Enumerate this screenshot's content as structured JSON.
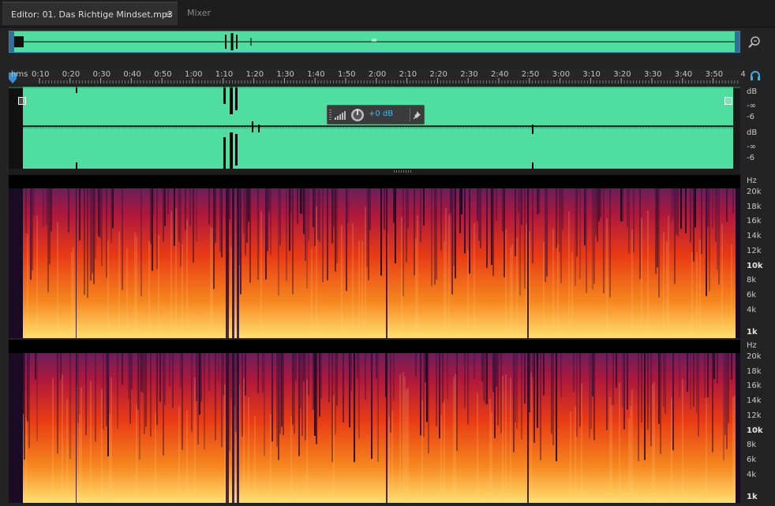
{
  "tabs": {
    "editor_label": "Editor: 01. Das Richtige Mindset.mp3",
    "menu_glyph": "≡",
    "mixer_label": "Mixer"
  },
  "ruler": {
    "unit_label": "hms",
    "tick_labels": [
      "0:10",
      "0:20",
      "0:30",
      "0:40",
      "0:50",
      "1:00",
      "1:10",
      "1:20",
      "1:30",
      "1:40",
      "1:50",
      "2:00",
      "2:10",
      "2:20",
      "2:30",
      "2:40",
      "2:50",
      "3:00",
      "3:10",
      "3:20",
      "3:30",
      "3:40",
      "3:50",
      "4"
    ]
  },
  "waveform_scale": {
    "top": [
      "dB",
      "-∞",
      "-6"
    ],
    "bottom": [
      "dB",
      "-∞",
      "-6"
    ]
  },
  "spectral_scale": {
    "unit": "Hz",
    "labels": [
      "20k",
      "18k",
      "16k",
      "14k",
      "12k",
      "10k",
      "8k",
      "6k",
      "4k",
      "1k"
    ],
    "bold": [
      "10k",
      "1k"
    ]
  },
  "hud": {
    "volume_value": "+0 dB"
  },
  "icons": {
    "zoom": "zoom-magnifier-icon",
    "monitor": "headphones-icon",
    "volume": "volume-bars-icon",
    "knob": "volume-knob-icon",
    "pin": "pin-icon"
  },
  "colors": {
    "waveform": "#4fdea0",
    "accent": "#2b8ab8",
    "hud_value": "#48b4e4",
    "spectral_low": "#ffe070",
    "spectral_mid": "#e83b14",
    "spectral_high": "#6a1f5a"
  }
}
